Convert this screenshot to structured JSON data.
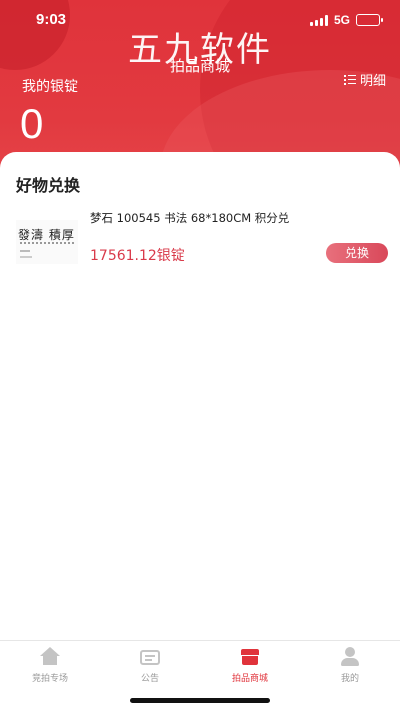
{
  "status_bar": {
    "time": "9:03",
    "network": "5G"
  },
  "watermark": "五九软件",
  "header": {
    "title": "拍品商城",
    "detail_label": "明细",
    "balance_label": "我的银锭",
    "balance_value": "0"
  },
  "section": {
    "title": "好物兑换"
  },
  "products": [
    {
      "name": "梦石 100545 书法 68*180CM 积分兑",
      "price": "17561.12银锭",
      "action_label": "兑换"
    }
  ],
  "tabbar": {
    "items": [
      {
        "label": "竞拍专场",
        "icon": "home-icon",
        "active": false
      },
      {
        "label": "公告",
        "icon": "notice-icon",
        "active": false
      },
      {
        "label": "拍品商城",
        "icon": "store-icon",
        "active": true
      },
      {
        "label": "我的",
        "icon": "user-icon",
        "active": false
      }
    ]
  },
  "colors": {
    "brand_red": "#e0333b",
    "price_red": "#d93a4a",
    "inactive_gray": "#999999"
  }
}
